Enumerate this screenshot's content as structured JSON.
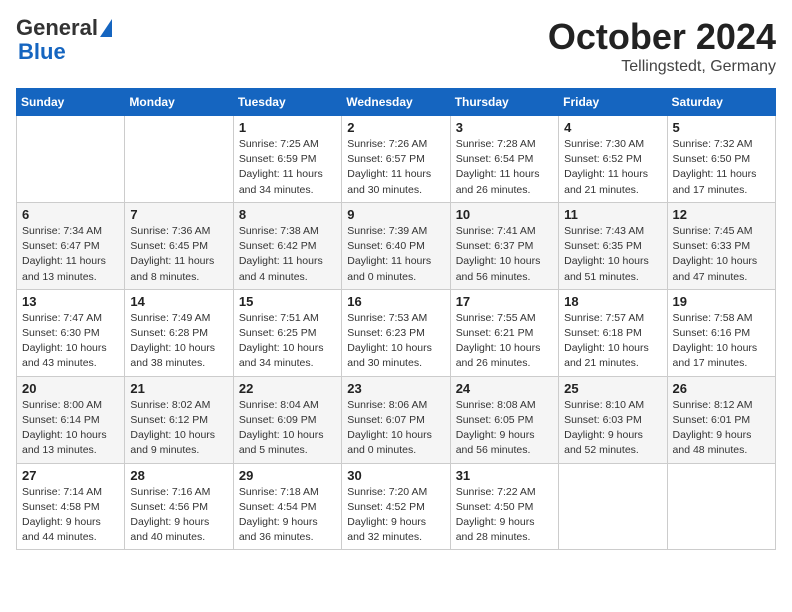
{
  "logo": {
    "line1": "General",
    "line2": "Blue"
  },
  "header": {
    "month": "October 2024",
    "location": "Tellingstedt, Germany"
  },
  "days_of_week": [
    "Sunday",
    "Monday",
    "Tuesday",
    "Wednesday",
    "Thursday",
    "Friday",
    "Saturday"
  ],
  "weeks": [
    [
      {
        "num": "",
        "info": ""
      },
      {
        "num": "",
        "info": ""
      },
      {
        "num": "1",
        "info": "Sunrise: 7:25 AM\nSunset: 6:59 PM\nDaylight: 11 hours\nand 34 minutes."
      },
      {
        "num": "2",
        "info": "Sunrise: 7:26 AM\nSunset: 6:57 PM\nDaylight: 11 hours\nand 30 minutes."
      },
      {
        "num": "3",
        "info": "Sunrise: 7:28 AM\nSunset: 6:54 PM\nDaylight: 11 hours\nand 26 minutes."
      },
      {
        "num": "4",
        "info": "Sunrise: 7:30 AM\nSunset: 6:52 PM\nDaylight: 11 hours\nand 21 minutes."
      },
      {
        "num": "5",
        "info": "Sunrise: 7:32 AM\nSunset: 6:50 PM\nDaylight: 11 hours\nand 17 minutes."
      }
    ],
    [
      {
        "num": "6",
        "info": "Sunrise: 7:34 AM\nSunset: 6:47 PM\nDaylight: 11 hours\nand 13 minutes."
      },
      {
        "num": "7",
        "info": "Sunrise: 7:36 AM\nSunset: 6:45 PM\nDaylight: 11 hours\nand 8 minutes."
      },
      {
        "num": "8",
        "info": "Sunrise: 7:38 AM\nSunset: 6:42 PM\nDaylight: 11 hours\nand 4 minutes."
      },
      {
        "num": "9",
        "info": "Sunrise: 7:39 AM\nSunset: 6:40 PM\nDaylight: 11 hours\nand 0 minutes."
      },
      {
        "num": "10",
        "info": "Sunrise: 7:41 AM\nSunset: 6:37 PM\nDaylight: 10 hours\nand 56 minutes."
      },
      {
        "num": "11",
        "info": "Sunrise: 7:43 AM\nSunset: 6:35 PM\nDaylight: 10 hours\nand 51 minutes."
      },
      {
        "num": "12",
        "info": "Sunrise: 7:45 AM\nSunset: 6:33 PM\nDaylight: 10 hours\nand 47 minutes."
      }
    ],
    [
      {
        "num": "13",
        "info": "Sunrise: 7:47 AM\nSunset: 6:30 PM\nDaylight: 10 hours\nand 43 minutes."
      },
      {
        "num": "14",
        "info": "Sunrise: 7:49 AM\nSunset: 6:28 PM\nDaylight: 10 hours\nand 38 minutes."
      },
      {
        "num": "15",
        "info": "Sunrise: 7:51 AM\nSunset: 6:25 PM\nDaylight: 10 hours\nand 34 minutes."
      },
      {
        "num": "16",
        "info": "Sunrise: 7:53 AM\nSunset: 6:23 PM\nDaylight: 10 hours\nand 30 minutes."
      },
      {
        "num": "17",
        "info": "Sunrise: 7:55 AM\nSunset: 6:21 PM\nDaylight: 10 hours\nand 26 minutes."
      },
      {
        "num": "18",
        "info": "Sunrise: 7:57 AM\nSunset: 6:18 PM\nDaylight: 10 hours\nand 21 minutes."
      },
      {
        "num": "19",
        "info": "Sunrise: 7:58 AM\nSunset: 6:16 PM\nDaylight: 10 hours\nand 17 minutes."
      }
    ],
    [
      {
        "num": "20",
        "info": "Sunrise: 8:00 AM\nSunset: 6:14 PM\nDaylight: 10 hours\nand 13 minutes."
      },
      {
        "num": "21",
        "info": "Sunrise: 8:02 AM\nSunset: 6:12 PM\nDaylight: 10 hours\nand 9 minutes."
      },
      {
        "num": "22",
        "info": "Sunrise: 8:04 AM\nSunset: 6:09 PM\nDaylight: 10 hours\nand 5 minutes."
      },
      {
        "num": "23",
        "info": "Sunrise: 8:06 AM\nSunset: 6:07 PM\nDaylight: 10 hours\nand 0 minutes."
      },
      {
        "num": "24",
        "info": "Sunrise: 8:08 AM\nSunset: 6:05 PM\nDaylight: 9 hours\nand 56 minutes."
      },
      {
        "num": "25",
        "info": "Sunrise: 8:10 AM\nSunset: 6:03 PM\nDaylight: 9 hours\nand 52 minutes."
      },
      {
        "num": "26",
        "info": "Sunrise: 8:12 AM\nSunset: 6:01 PM\nDaylight: 9 hours\nand 48 minutes."
      }
    ],
    [
      {
        "num": "27",
        "info": "Sunrise: 7:14 AM\nSunset: 4:58 PM\nDaylight: 9 hours\nand 44 minutes."
      },
      {
        "num": "28",
        "info": "Sunrise: 7:16 AM\nSunset: 4:56 PM\nDaylight: 9 hours\nand 40 minutes."
      },
      {
        "num": "29",
        "info": "Sunrise: 7:18 AM\nSunset: 4:54 PM\nDaylight: 9 hours\nand 36 minutes."
      },
      {
        "num": "30",
        "info": "Sunrise: 7:20 AM\nSunset: 4:52 PM\nDaylight: 9 hours\nand 32 minutes."
      },
      {
        "num": "31",
        "info": "Sunrise: 7:22 AM\nSunset: 4:50 PM\nDaylight: 9 hours\nand 28 minutes."
      },
      {
        "num": "",
        "info": ""
      },
      {
        "num": "",
        "info": ""
      }
    ]
  ]
}
